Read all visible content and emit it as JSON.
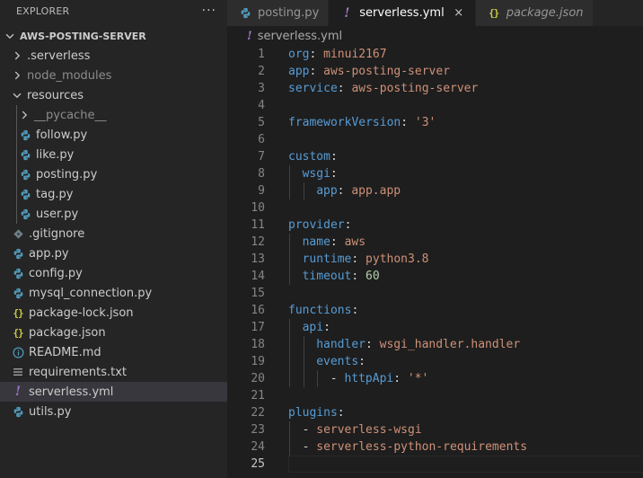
{
  "sidebar": {
    "title": "EXPLORER",
    "more_label": "···",
    "project": "AWS-POSTING-SERVER",
    "items": [
      {
        "label": ".serverless",
        "depth": 1,
        "kind": "folder",
        "expanded": false,
        "icon": "chevron-right-icon"
      },
      {
        "label": "node_modules",
        "depth": 1,
        "kind": "folder",
        "expanded": false,
        "dim": true,
        "icon": "chevron-right-icon"
      },
      {
        "label": "resources",
        "depth": 1,
        "kind": "folder",
        "expanded": true,
        "icon": "chevron-down-icon"
      },
      {
        "label": "__pycache__",
        "depth": 2,
        "kind": "folder",
        "expanded": false,
        "dim": true,
        "icon": "chevron-right-icon"
      },
      {
        "label": "follow.py",
        "depth": 2,
        "kind": "python",
        "icon": "python-icon"
      },
      {
        "label": "like.py",
        "depth": 2,
        "kind": "python",
        "icon": "python-icon"
      },
      {
        "label": "posting.py",
        "depth": 2,
        "kind": "python",
        "icon": "python-icon"
      },
      {
        "label": "tag.py",
        "depth": 2,
        "kind": "python",
        "icon": "python-icon"
      },
      {
        "label": "user.py",
        "depth": 2,
        "kind": "python",
        "icon": "python-icon"
      },
      {
        "label": ".gitignore",
        "depth": 1,
        "kind": "git",
        "icon": "git-icon"
      },
      {
        "label": "app.py",
        "depth": 1,
        "kind": "python",
        "icon": "python-icon"
      },
      {
        "label": "config.py",
        "depth": 1,
        "kind": "python",
        "icon": "python-icon"
      },
      {
        "label": "mysql_connection.py",
        "depth": 1,
        "kind": "python",
        "icon": "python-icon"
      },
      {
        "label": "package-lock.json",
        "depth": 1,
        "kind": "json",
        "icon": "json-braces-icon"
      },
      {
        "label": "package.json",
        "depth": 1,
        "kind": "json",
        "icon": "json-braces-icon"
      },
      {
        "label": "README.md",
        "depth": 1,
        "kind": "info",
        "icon": "info-icon"
      },
      {
        "label": "requirements.txt",
        "depth": 1,
        "kind": "text",
        "icon": "lines-icon"
      },
      {
        "label": "serverless.yml",
        "depth": 1,
        "kind": "yaml",
        "active": true,
        "icon": "exclamation-icon"
      },
      {
        "label": "utils.py",
        "depth": 1,
        "kind": "python",
        "icon": "python-icon"
      }
    ]
  },
  "tabs": [
    {
      "label": "posting.py",
      "kind": "python",
      "active": false,
      "italic": false,
      "icon": "python-icon"
    },
    {
      "label": "serverless.yml",
      "kind": "yaml",
      "active": true,
      "italic": false,
      "close": "×",
      "icon": "exclamation-icon"
    },
    {
      "label": "package.json",
      "kind": "json",
      "active": false,
      "italic": true,
      "icon": "json-braces-icon"
    }
  ],
  "breadcrumb": {
    "label": "serverless.yml",
    "icon": "exclamation-icon"
  },
  "editor": {
    "current_line": 25,
    "lines": [
      {
        "n": "1",
        "indent": 0,
        "tokens": [
          {
            "t": "org",
            "c": "k"
          },
          {
            "t": ": ",
            "c": "p"
          },
          {
            "t": "minui2167",
            "c": "s"
          }
        ]
      },
      {
        "n": "2",
        "indent": 0,
        "tokens": [
          {
            "t": "app",
            "c": "k"
          },
          {
            "t": ": ",
            "c": "p"
          },
          {
            "t": "aws-posting-server",
            "c": "s"
          }
        ]
      },
      {
        "n": "3",
        "indent": 0,
        "tokens": [
          {
            "t": "service",
            "c": "k"
          },
          {
            "t": ": ",
            "c": "p"
          },
          {
            "t": "aws-posting-server",
            "c": "s"
          }
        ]
      },
      {
        "n": "4",
        "indent": 0,
        "tokens": []
      },
      {
        "n": "5",
        "indent": 0,
        "tokens": [
          {
            "t": "frameworkVersion",
            "c": "k"
          },
          {
            "t": ": ",
            "c": "p"
          },
          {
            "t": "'3'",
            "c": "s"
          }
        ]
      },
      {
        "n": "6",
        "indent": 0,
        "tokens": []
      },
      {
        "n": "7",
        "indent": 0,
        "tokens": [
          {
            "t": "custom",
            "c": "k"
          },
          {
            "t": ":",
            "c": "p"
          }
        ]
      },
      {
        "n": "8",
        "indent": 1,
        "tokens": [
          {
            "t": "wsgi",
            "c": "k"
          },
          {
            "t": ":",
            "c": "p"
          }
        ]
      },
      {
        "n": "9",
        "indent": 2,
        "tokens": [
          {
            "t": "app",
            "c": "k"
          },
          {
            "t": ": ",
            "c": "p"
          },
          {
            "t": "app.app",
            "c": "s"
          }
        ]
      },
      {
        "n": "10",
        "indent": 0,
        "tokens": []
      },
      {
        "n": "11",
        "indent": 0,
        "tokens": [
          {
            "t": "provider",
            "c": "k"
          },
          {
            "t": ":",
            "c": "p"
          }
        ]
      },
      {
        "n": "12",
        "indent": 1,
        "tokens": [
          {
            "t": "name",
            "c": "k"
          },
          {
            "t": ": ",
            "c": "p"
          },
          {
            "t": "aws",
            "c": "s"
          }
        ]
      },
      {
        "n": "13",
        "indent": 1,
        "tokens": [
          {
            "t": "runtime",
            "c": "k"
          },
          {
            "t": ": ",
            "c": "p"
          },
          {
            "t": "python3.8",
            "c": "s"
          }
        ]
      },
      {
        "n": "14",
        "indent": 1,
        "tokens": [
          {
            "t": "timeout",
            "c": "k"
          },
          {
            "t": ": ",
            "c": "p"
          },
          {
            "t": "60",
            "c": "n"
          }
        ]
      },
      {
        "n": "15",
        "indent": 0,
        "tokens": []
      },
      {
        "n": "16",
        "indent": 0,
        "tokens": [
          {
            "t": "functions",
            "c": "k"
          },
          {
            "t": ":",
            "c": "p"
          }
        ]
      },
      {
        "n": "17",
        "indent": 1,
        "tokens": [
          {
            "t": "api",
            "c": "k"
          },
          {
            "t": ":",
            "c": "p"
          }
        ]
      },
      {
        "n": "18",
        "indent": 2,
        "tokens": [
          {
            "t": "handler",
            "c": "k"
          },
          {
            "t": ": ",
            "c": "p"
          },
          {
            "t": "wsgi_handler.handler",
            "c": "s"
          }
        ]
      },
      {
        "n": "19",
        "indent": 2,
        "tokens": [
          {
            "t": "events",
            "c": "k"
          },
          {
            "t": ":",
            "c": "p"
          }
        ]
      },
      {
        "n": "20",
        "indent": 3,
        "tokens": [
          {
            "t": "- ",
            "c": "p"
          },
          {
            "t": "httpApi",
            "c": "k"
          },
          {
            "t": ": ",
            "c": "p"
          },
          {
            "t": "'*'",
            "c": "s"
          }
        ]
      },
      {
        "n": "21",
        "indent": 0,
        "tokens": []
      },
      {
        "n": "22",
        "indent": 0,
        "tokens": [
          {
            "t": "plugins",
            "c": "k"
          },
          {
            "t": ":",
            "c": "p"
          }
        ]
      },
      {
        "n": "23",
        "indent": 1,
        "tokens": [
          {
            "t": "- ",
            "c": "p"
          },
          {
            "t": "serverless-wsgi",
            "c": "s"
          }
        ]
      },
      {
        "n": "24",
        "indent": 1,
        "tokens": [
          {
            "t": "- ",
            "c": "p"
          },
          {
            "t": "serverless-python-requirements",
            "c": "s"
          }
        ]
      },
      {
        "n": "25",
        "indent": 0,
        "tokens": []
      }
    ]
  },
  "colors": {
    "python": "#519aba",
    "yaml": "#a074c4",
    "json": "#cbcb41",
    "git": "#6d8086",
    "info": "#519aba",
    "text": "#a0a0a0",
    "chevron": "#c5c5c5"
  }
}
